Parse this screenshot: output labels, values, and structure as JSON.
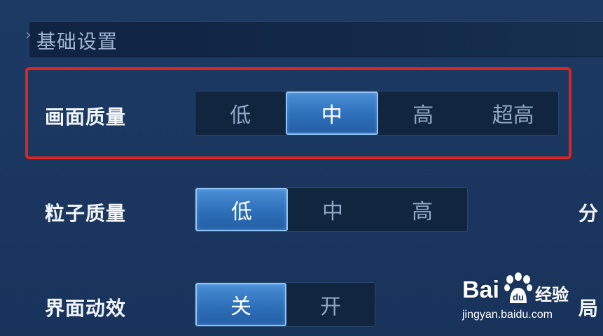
{
  "header": {
    "title": "基础设置"
  },
  "settings": [
    {
      "label": "画面质量",
      "options": [
        "低",
        "中",
        "高",
        "超高"
      ],
      "selected": 1
    },
    {
      "label": "粒子质量",
      "options": [
        "低",
        "中",
        "高"
      ],
      "selected": 0
    },
    {
      "label": "界面动效",
      "options": [
        "关",
        "开"
      ],
      "selected": 0
    }
  ],
  "right_cut": {
    "row2": "分",
    "row3": "局"
  },
  "watermark": {
    "main": "Bai",
    "paw": "du",
    "cn": "经验",
    "url": "jingyan.baidu.com"
  },
  "colors": {
    "active": "#2d6fb8",
    "highlight_border": "#e2221c",
    "background": "#1c3a63"
  }
}
